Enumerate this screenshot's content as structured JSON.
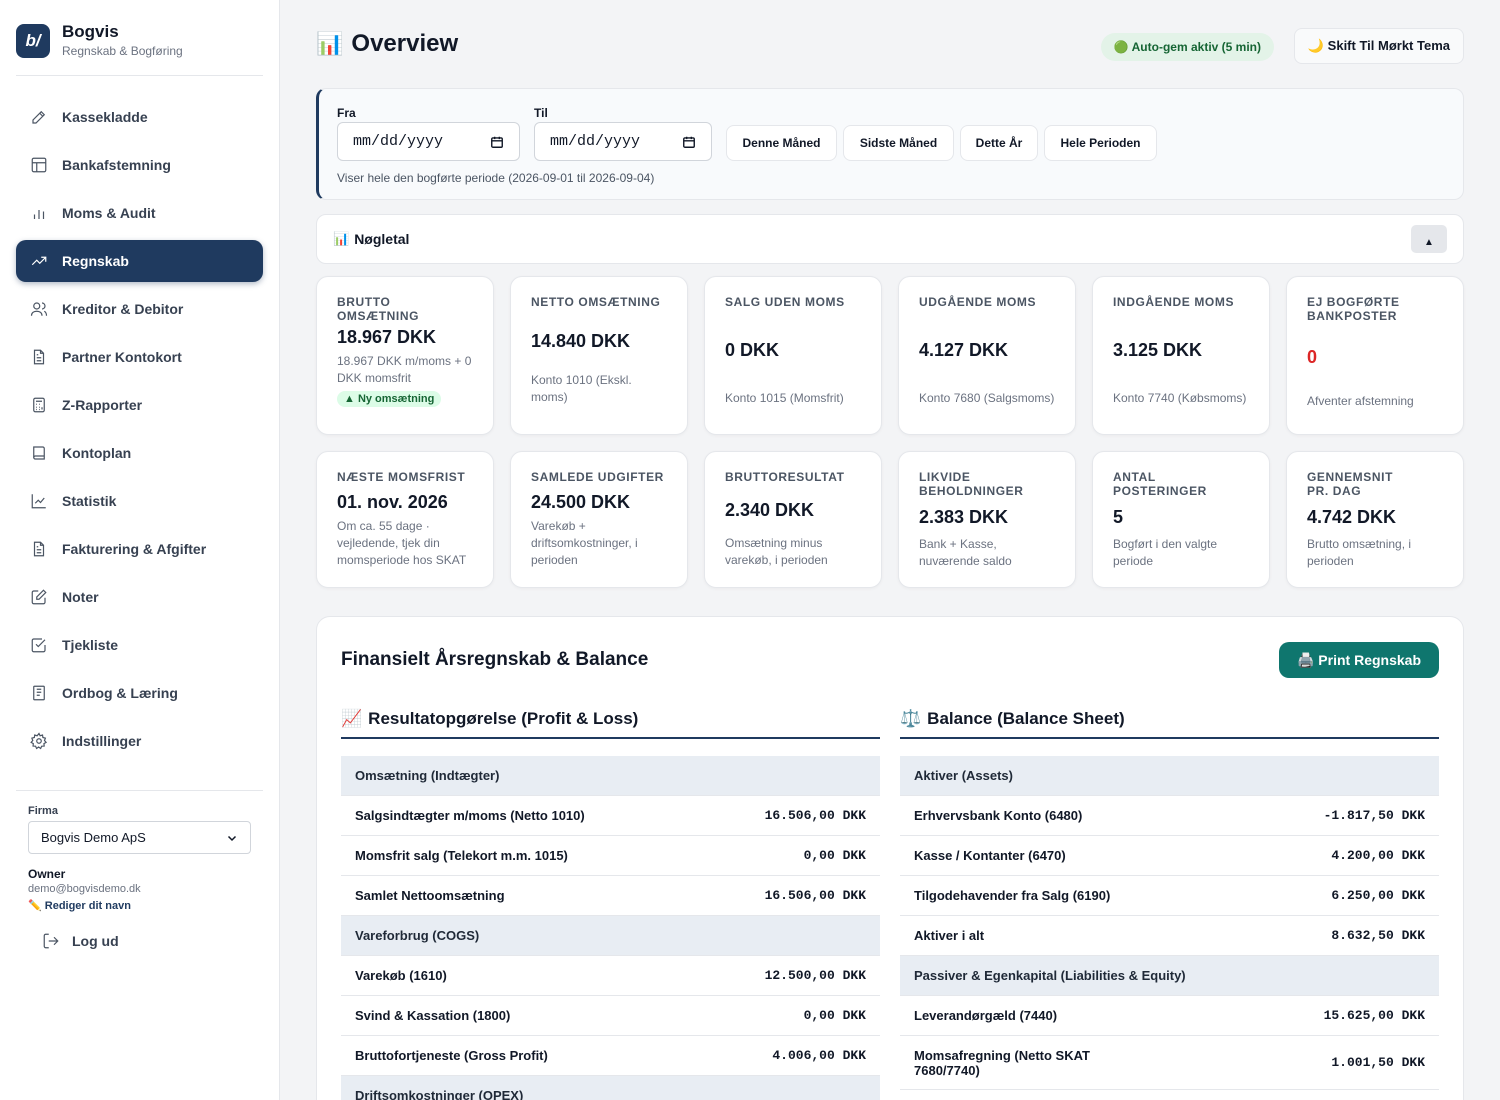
{
  "brand": {
    "name": "Bogvis",
    "subtitle": "Regnskab & Bogføring",
    "logo_text": "b/"
  },
  "nav": {
    "items": [
      {
        "label": "Kassekladde",
        "icon": "pencil-icon"
      },
      {
        "label": "Bankafstemning",
        "icon": "layout-icon"
      },
      {
        "label": "Moms & Audit",
        "icon": "bar-chart-icon"
      },
      {
        "label": "Regnskab",
        "icon": "trending-up-icon",
        "active": true
      },
      {
        "label": "Kreditor & Debitor",
        "icon": "users-icon"
      },
      {
        "label": "Partner Kontokort",
        "icon": "file-text-icon"
      },
      {
        "label": "Z-Rapporter",
        "icon": "calculator-icon"
      },
      {
        "label": "Kontoplan",
        "icon": "book-icon"
      },
      {
        "label": "Statistik",
        "icon": "line-chart-icon"
      },
      {
        "label": "Fakturering & Afgifter",
        "icon": "file-text-icon"
      },
      {
        "label": "Noter",
        "icon": "edit-icon"
      },
      {
        "label": "Tjekliste",
        "icon": "check-square-icon"
      },
      {
        "label": "Ordbog & Læring",
        "icon": "book-open-icon"
      },
      {
        "label": "Indstillinger",
        "icon": "gear-icon"
      }
    ]
  },
  "account": {
    "firma_label": "Firma",
    "firma_selected": "Bogvis Demo ApS",
    "role": "Owner",
    "email": "demo@bogvisdemo.dk",
    "edit_name": "✏️ Rediger dit navn",
    "logout": "Log ud"
  },
  "header": {
    "title_icon": "📊",
    "title": "Overview",
    "autosave": "🟢 Auto-gem aktiv (5 min)",
    "theme_button": "🌙  Skift Til Mørkt Tema"
  },
  "filter": {
    "from_label": "Fra",
    "to_label": "Til",
    "from_placeholder": "mm/dd/yyyy",
    "to_placeholder": "mm/dd/yyyy",
    "quick": [
      "Denne Måned",
      "Sidste Måned",
      "Dette År",
      "Hele Perioden"
    ],
    "note": "Viser hele den bogførte periode (2026-09-01 til 2026-09-04)"
  },
  "kpi": {
    "header_icon": "📊",
    "header": "Nøgletal",
    "collapse": "▲",
    "cards": [
      {
        "label": "BRUTTO OMSÆTNING",
        "value": "18.967 DKK",
        "note": "18.967 DKK m/moms + 0 DKK momsfrit",
        "badge": "▲ Ny omsætning"
      },
      {
        "label": "NETTO OMSÆTNING",
        "value": "14.840 DKK",
        "note": "Konto 1010 (Ekskl. moms)"
      },
      {
        "label": "SALG UDEN MOMS",
        "value": "0 DKK",
        "note": "Konto 1015 (Momsfrit)"
      },
      {
        "label": "UDGÅENDE MOMS",
        "value": "4.127 DKK",
        "note": "Konto 7680 (Salgsmoms)"
      },
      {
        "label": "INDGÅENDE MOMS",
        "value": "3.125 DKK",
        "note": "Konto 7740 (Købsmoms)"
      },
      {
        "label": "EJ BOGFØRTE BANKPOSTER",
        "value": "0",
        "note": "Afventer afstemning"
      },
      {
        "label": "NÆSTE MOMSFRIST",
        "value": "01. nov. 2026",
        "note": "Om ca. 55 dage · vejledende, tjek din momsperiode hos SKAT"
      },
      {
        "label": "SAMLEDE UDGIFTER",
        "value": "24.500 DKK",
        "note": "Varekøb + driftsomkostninger, i perioden"
      },
      {
        "label": "BRUTTORESULTAT",
        "value": "2.340 DKK",
        "note": "Omsætning minus varekøb, i perioden"
      },
      {
        "label": "LIKVIDE BEHOLDNINGER",
        "value": "2.383 DKK",
        "note": "Bank + Kasse, nuværende saldo"
      },
      {
        "label": "ANTAL POSTERINGER",
        "value": "5",
        "note": "Bogført i den valgte periode"
      },
      {
        "label": "GENNEMSNIT PR. DAG",
        "value": "4.742 DKK",
        "note": "Brutto omsætning, i perioden"
      }
    ]
  },
  "report": {
    "title": "Finansielt Årsregnskab & Balance",
    "print": "🖨️ Print Regnskab",
    "pl": {
      "icon": "📈",
      "title": "Resultatopgørelse (Profit & Loss)",
      "rows": [
        {
          "label": "Omsætning (Indtægter)",
          "amount": "",
          "section": true
        },
        {
          "label": "Salgsindtægter m/moms (Netto 1010)",
          "amount": "16.506,00 DKK"
        },
        {
          "label": "Momsfrit salg (Telekort m.m. 1015)",
          "amount": "0,00 DKK"
        },
        {
          "label": "Samlet Nettoomsætning",
          "amount": "16.506,00 DKK"
        },
        {
          "label": "Vareforbrug (COGS)",
          "amount": "",
          "section": true
        },
        {
          "label": "Varekøb (1610)",
          "amount": "12.500,00 DKK"
        },
        {
          "label": "Svind & Kassation (1800)",
          "amount": "0,00 DKK"
        },
        {
          "label": "Bruttofortjeneste (Gross Profit)",
          "amount": "4.006,00 DKK"
        },
        {
          "label": "Driftsomkostninger (OPEX)",
          "amount": "",
          "section": true
        }
      ]
    },
    "balance": {
      "icon": "⚖️",
      "title": "Balance (Balance Sheet)",
      "rows": [
        {
          "label": "Aktiver (Assets)",
          "amount": "",
          "section": true
        },
        {
          "label": "Erhvervsbank Konto (6480)",
          "amount": "-1.817,50 DKK"
        },
        {
          "label": "Kasse / Kontanter (6470)",
          "amount": "4.200,00 DKK"
        },
        {
          "label": "Tilgodehavender fra Salg (6190)",
          "amount": "6.250,00 DKK"
        },
        {
          "label": "Aktiver i alt",
          "amount": "8.632,50 DKK"
        },
        {
          "label": "Passiver & Egenkapital (Liabilities & Equity)",
          "amount": "",
          "section": true
        },
        {
          "label": "Leverandørgæld (7440)",
          "amount": "15.625,00 DKK"
        },
        {
          "label": "Momsafregning (Netto SKAT 7680/7740)",
          "amount": "1.001,50 DKK"
        }
      ]
    }
  },
  "colors": {
    "primary": "#1f3a5f",
    "accent": "#0f766e",
    "danger": "#dc2626",
    "success_bg": "#e3f3e8"
  }
}
